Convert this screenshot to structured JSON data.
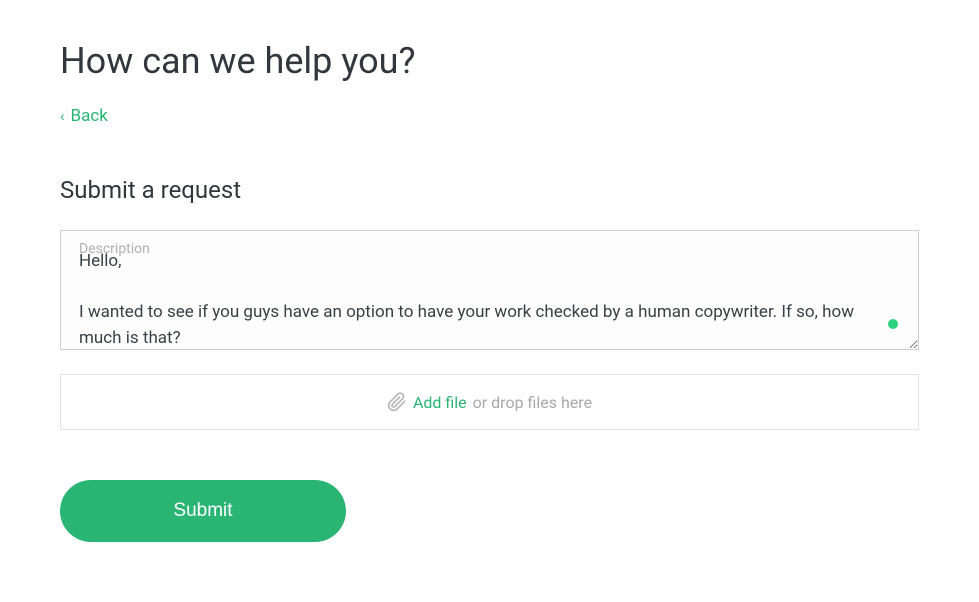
{
  "header": {
    "title": "How can we help you?",
    "back_label": "Back"
  },
  "form": {
    "section_title": "Submit a request",
    "description_label": "Description",
    "description_value": "Hello,\n\nI wanted to see if you guys have an option to have your work checked by a human copywriter. If so, how much is that?",
    "file_add_label": "Add file",
    "file_hint_label": "or drop files here",
    "submit_label": "Submit"
  }
}
